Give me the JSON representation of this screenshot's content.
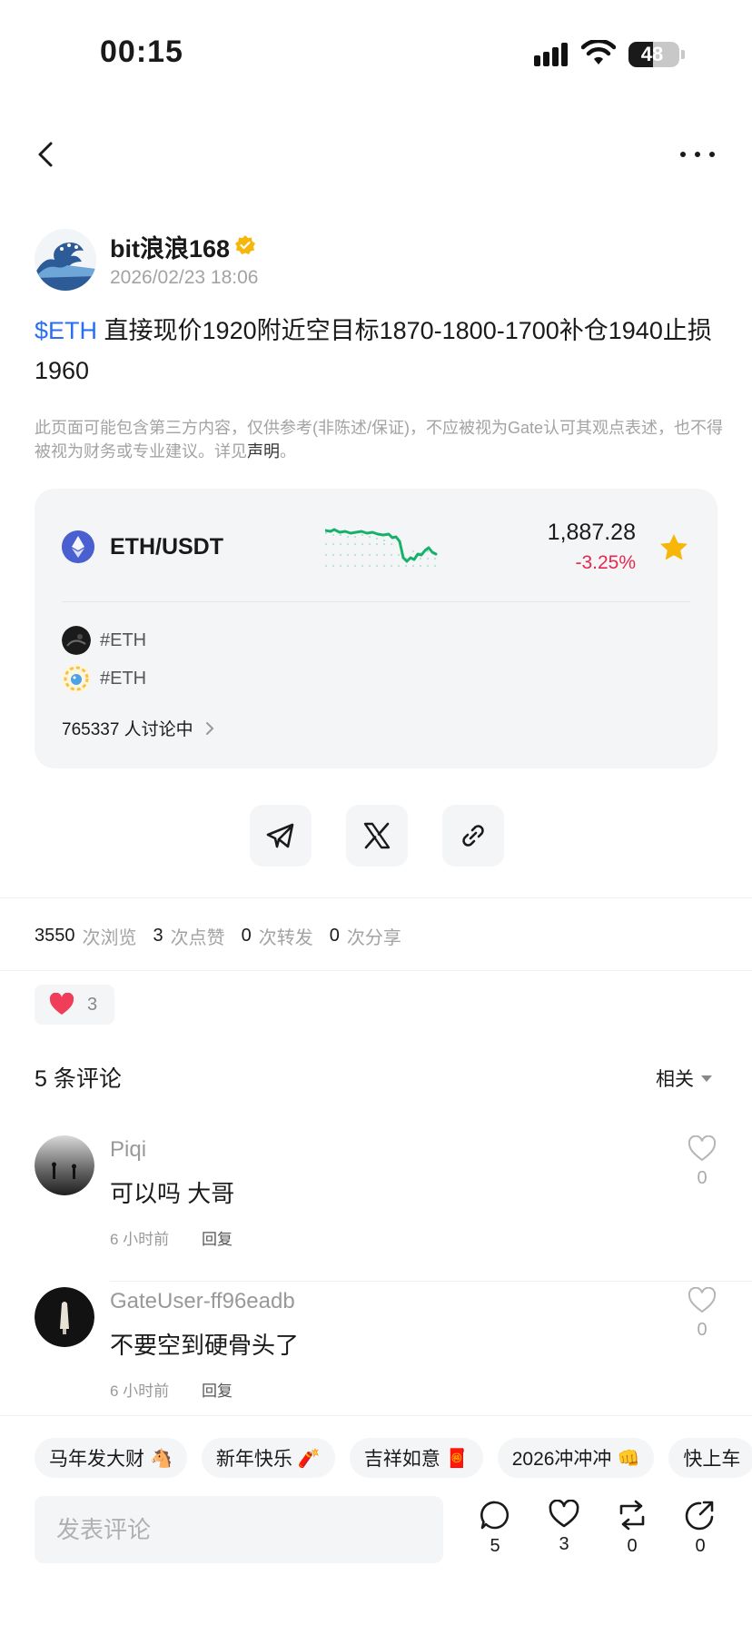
{
  "status_bar": {
    "time": "00:15",
    "battery": "48",
    "battery_level": 0.48
  },
  "author": {
    "name": "bit浪浪168",
    "date": "2026/02/23 18:06"
  },
  "post": {
    "ticker": "$ETH",
    "text": " 直接现价1920附近空目标1870-1800-1700补仓1940止损1960"
  },
  "disclaimer": {
    "text": "此页面可能包含第三方内容，仅供参考(非陈述/保证)，不应被视为Gate认可其观点表述，也不得被视为财务或专业建议。详见",
    "link": "声明",
    "end": "。"
  },
  "market": {
    "pair": "ETH/USDT",
    "price": "1,887.28",
    "change": "-3.25%",
    "tags": [
      "#ETH",
      "#ETH"
    ],
    "discussion": "765337 人讨论中"
  },
  "share": {
    "telegram": "telegram-icon",
    "x": "x-icon",
    "link": "link-icon"
  },
  "stats": {
    "views": "3550",
    "views_label": "次浏览",
    "likes": "3",
    "likes_label": "次点赞",
    "reposts": "0",
    "reposts_label": "次转发",
    "shares": "0",
    "shares_label": "次分享"
  },
  "reaction": {
    "count": "3"
  },
  "comments": {
    "title": "5 条评论",
    "sort": "相关",
    "items": [
      {
        "user": "Piqi",
        "text": "可以吗 大哥",
        "time": "6 小时前",
        "reply": "回复",
        "likes": "0"
      },
      {
        "user": "GateUser-ff96eadb",
        "text": "不要空到硬骨头了",
        "time": "6 小时前",
        "reply": "回复",
        "likes": "0"
      }
    ]
  },
  "quick_replies": [
    {
      "text": "马年发大财",
      "emoji": "🐴"
    },
    {
      "text": "新年快乐",
      "emoji": "🧨"
    },
    {
      "text": "吉祥如意",
      "emoji": "🧧"
    },
    {
      "text": "2026冲冲冲",
      "emoji": "👊"
    },
    {
      "text": "快上车",
      "emoji": ""
    }
  ],
  "bottom_bar": {
    "placeholder": "发表评论",
    "comment_count": "5",
    "like_count": "3",
    "repost_count": "0",
    "share_count": "0"
  },
  "colors": {
    "accent": "#2a6ef5",
    "down": "#e5294e",
    "up": "#17b26a",
    "star": "#f6b70a",
    "heart": "#f03e5a"
  }
}
